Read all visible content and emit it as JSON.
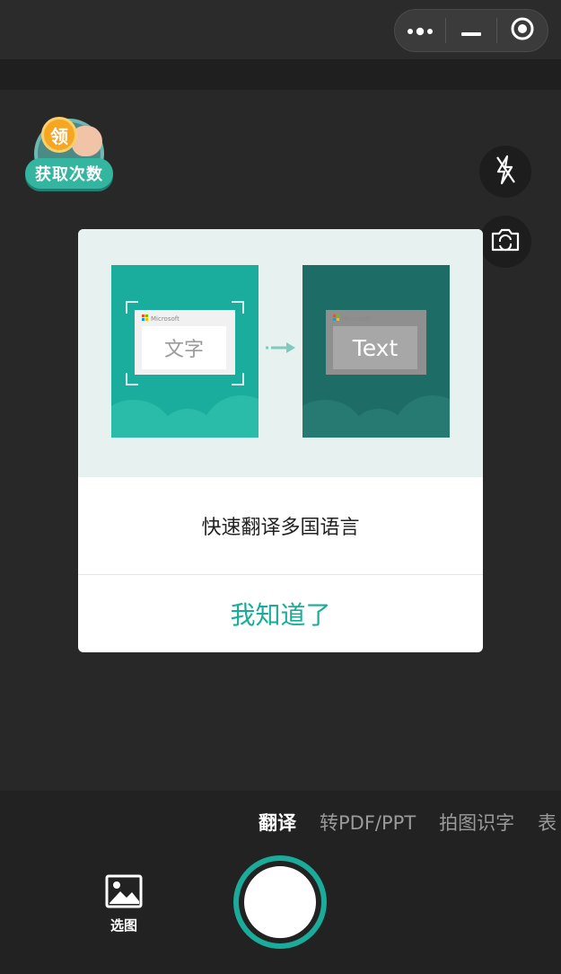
{
  "capsule": {
    "more_icon": "more-dots-icon",
    "minimize_icon": "minus-icon",
    "close_icon": "target-circle-icon"
  },
  "badge": {
    "coin_char": "领",
    "label": "获取次数"
  },
  "side_buttons": {
    "flash_icon": "flash-off-icon",
    "switch_camera_icon": "camera-switch-icon"
  },
  "modal": {
    "left_card": {
      "brand": "Microsoft",
      "text": "文字"
    },
    "right_card": {
      "brand": "Microsoft",
      "text": "Text"
    },
    "message": "快速翻译多国语言",
    "confirm_label": "我知道了"
  },
  "mode_tabs": {
    "items": [
      "翻译",
      "转PDF/PPT",
      "拍图识字",
      "表"
    ],
    "active": "翻译"
  },
  "album_label": "选图",
  "colors": {
    "accent": "#1aab9a",
    "background": "#282828"
  }
}
